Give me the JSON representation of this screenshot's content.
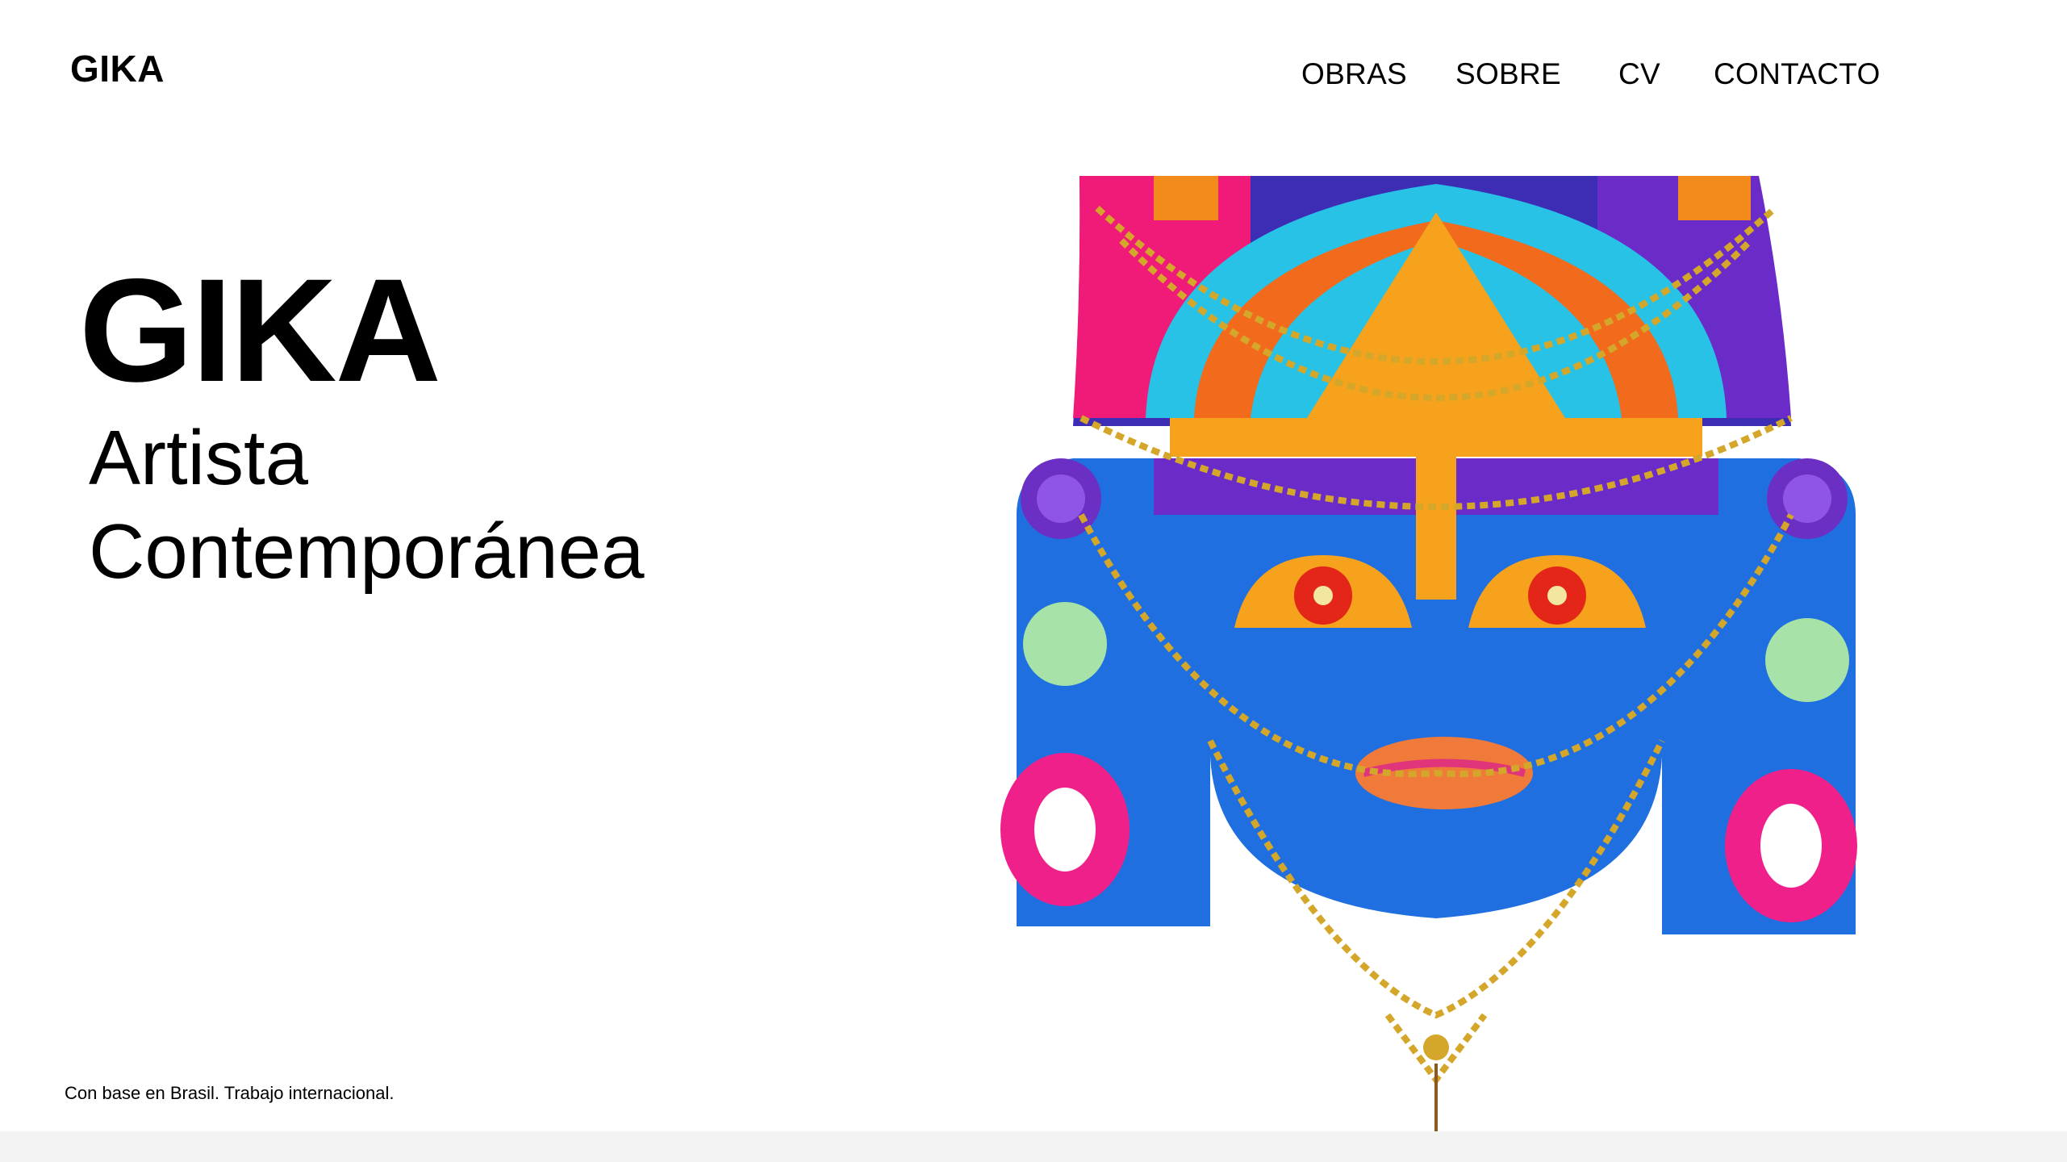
{
  "header": {
    "logo": "GIKA",
    "nav": [
      {
        "label": "OBRAS"
      },
      {
        "label": "SOBRE"
      },
      {
        "label": "CV"
      },
      {
        "label": "CONTACTO"
      }
    ]
  },
  "hero": {
    "title": "GIKA",
    "subtitle_line1": "Artista",
    "subtitle_line2": "Contemporánea"
  },
  "footer": {
    "note": "Con base en Brasil. Trabajo internacional."
  },
  "artwork": {
    "subject": "colorful-mask-artwork"
  },
  "colors": {
    "background": "#ffffff",
    "text": "#000000",
    "bottom_bar": "#f3f3f3",
    "mask_blue": "#1f6fe0",
    "mask_orange": "#f6a21c",
    "mask_pink": "#f0208a",
    "mask_purple": "#6b2fc4",
    "gold": "#d4a629"
  }
}
